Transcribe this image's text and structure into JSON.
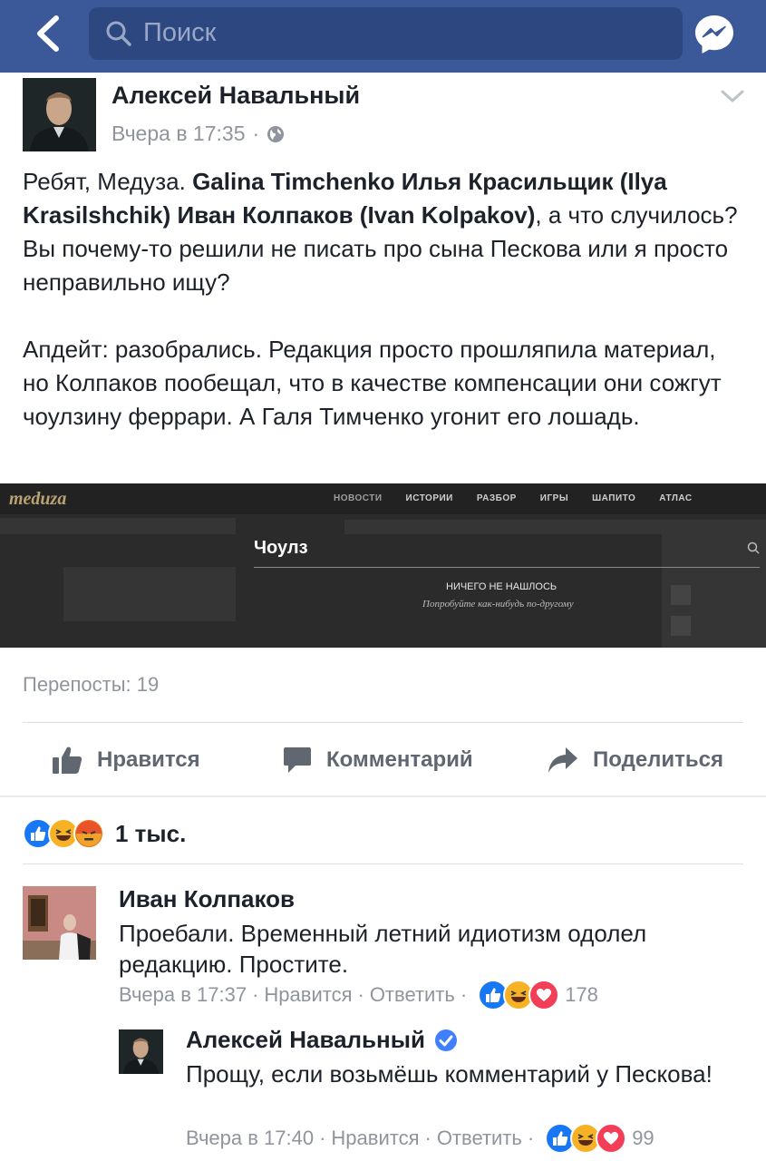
{
  "topbar": {
    "search_placeholder": "Поиск"
  },
  "post": {
    "author": "Алексей Навальный",
    "time": "Вчера в 17:35",
    "separator": "·",
    "text_intro": "Ребят, Медуза. ",
    "tag1": "Galina Timchenko",
    "tag2": "Илья Красильщик (Ilya Krasilshchik)",
    "tag3": "Иван Колпаков (Ivan Kolpakov)",
    "text_rest": ", а что случилось? Вы почему-то решили не писать про сына Пескова или я просто неправильно ищу?",
    "paragraph2": "Апдейт: разобрались. Редакция просто прошляпила материал, но Колпаков пообещал, что в качестве компенсации они сожгут чоулзину феррари. А Галя Тимченко угонит его лошадь."
  },
  "screenshot": {
    "logo": "meduza",
    "menu": [
      "НОВОСТИ",
      "ИСТОРИИ",
      "РАЗБОР",
      "ИГРЫ",
      "ШАПИТО",
      "АТЛАС"
    ],
    "query": "Чоулз",
    "not_found": "НИЧЕГО НЕ НАШЛОСЬ",
    "hint": "Попробуйте как-нибудь по-другому"
  },
  "stats": {
    "reposts": "Перепосты: 19"
  },
  "actions": {
    "like": "Нравится",
    "comment": "Комментарий",
    "share": "Поделиться"
  },
  "reactions": {
    "count": "1 тыс."
  },
  "comments": [
    {
      "author": "Иван Колпаков",
      "text": "Проебали. Временный летний идиотизм одолел редакцию. Простите.",
      "time": "Вчера в 17:37",
      "like": "Нравится",
      "reply": "Ответить",
      "reactions_count": "178"
    },
    {
      "author": "Алексей Навальный",
      "text": "Прощу, если возьмёшь комментарий у Пескова!",
      "time": "Вчера в 17:40",
      "like": "Нравится",
      "reply": "Ответить",
      "reactions_count": "99"
    }
  ],
  "colors": {
    "brand": "#3b5998",
    "like_blue": "#1877f2",
    "love_red": "#f33e58",
    "haha_yellow": "#f7b125",
    "verified_blue": "#4080ff"
  }
}
